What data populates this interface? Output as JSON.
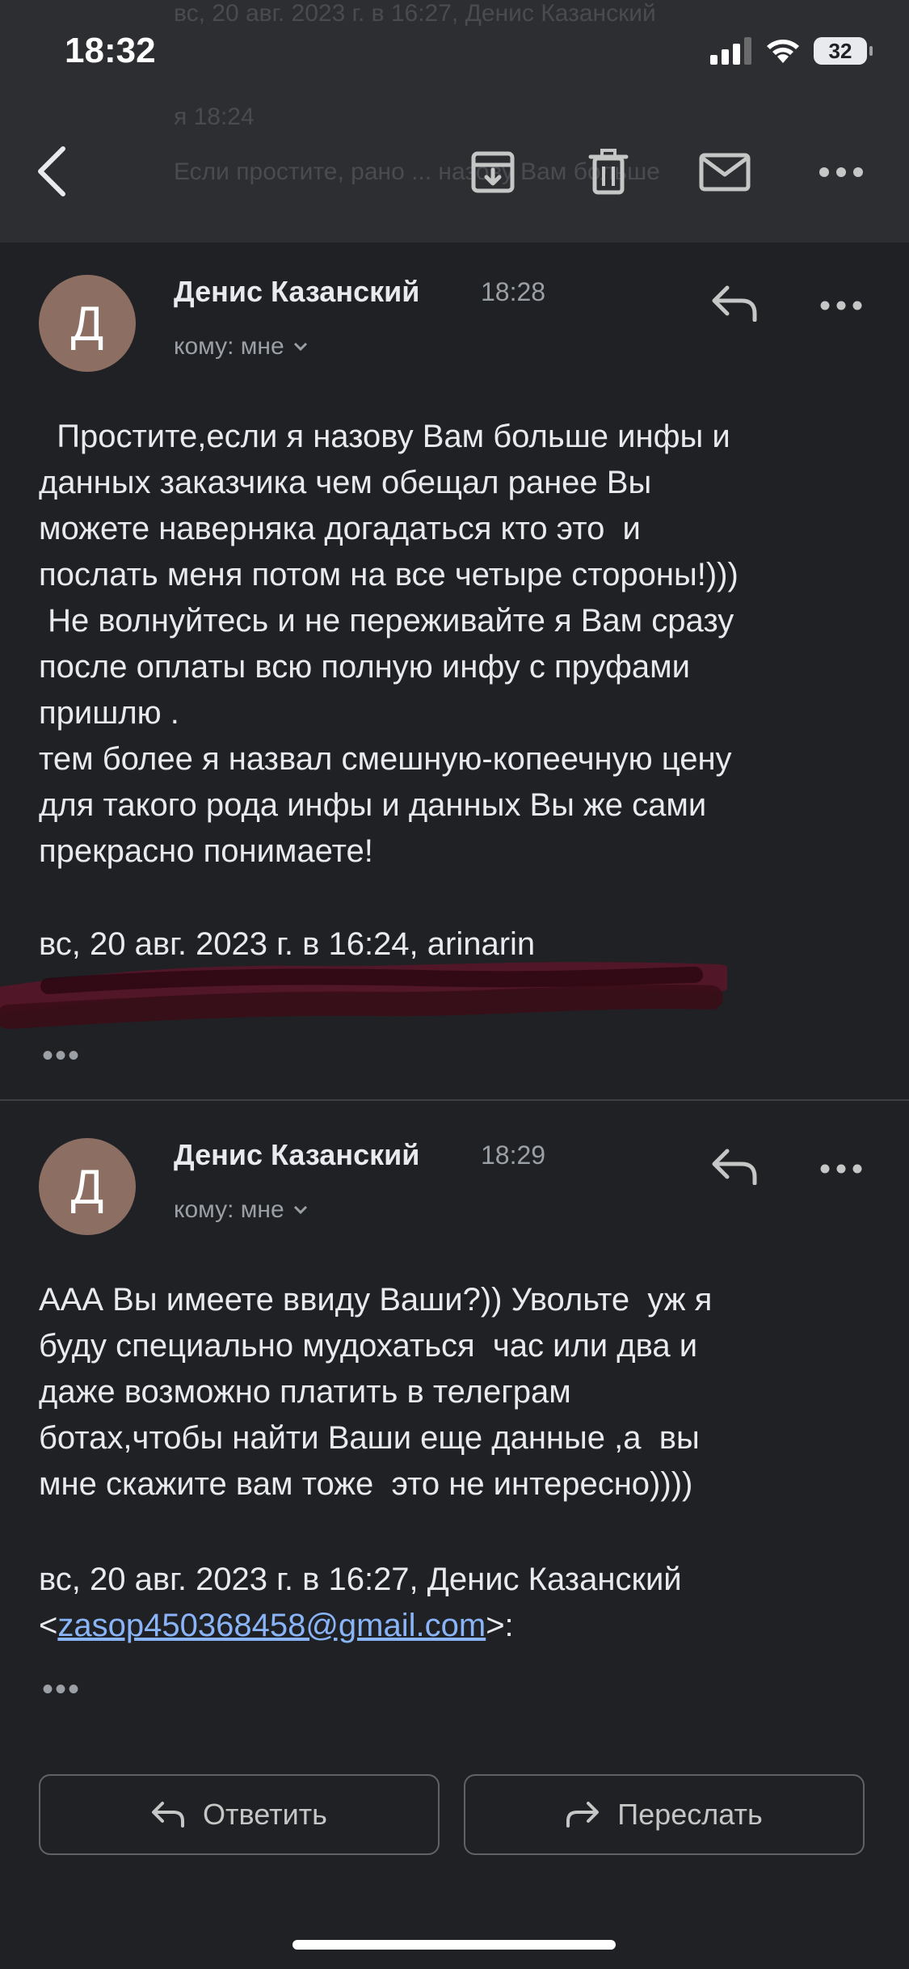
{
  "status_bar": {
    "time": "18:32",
    "battery": "32"
  },
  "background_header": {
    "line1": "вс, 20 авг. 2023 г. в 16:27, Денис Казанский",
    "line2": "я 18:24",
    "line3": "Если простите, рано ... назову Вам больше"
  },
  "toolbar": {
    "back": "back-icon",
    "archive": "archive-icon",
    "delete": "trash-icon",
    "mark_unread": "mail-icon",
    "more": "more-icon"
  },
  "messages": [
    {
      "avatar_letter": "Д",
      "sender": "Денис Казанский",
      "time": "18:28",
      "to": "кому: мне",
      "body": "  Простите,если я назову Вам больше инфы и\nданных заказчика чем обещал ранее Вы\nможете наверняка догадаться кто это  и\nпослать меня потом на все четыре стороны!)))\n Не волнуйтесь и не переживайте я Вам сразу\nпосле оплаты всю полную инфу с пруфами\nпришлю .\nтем более я назвал смешную-копеечную цену\nдля такого рода инфы и данных Вы же сами\nпрекрасно понимаете!",
      "quote_line": "вс, 20 авг. 2023 г. в 16:24, arinarin",
      "ellipsis": "•••"
    },
    {
      "avatar_letter": "Д",
      "sender": "Денис Казанский",
      "time": "18:29",
      "to": "кому: мне",
      "body": "ААА Вы имеете ввиду Ваши?)) Увольте  уж я\nбуду специально мудохаться  час или два и\nдаже возможно платить в телеграм\nботах,чтобы найти Ваши еще данные ,а  вы\nмне скажите вам тоже  это не интересно))))",
      "quote_line": "вс, 20 авг. 2023 г. в 16:27, Денис Казанский",
      "quote_email_prefix": "<",
      "quote_email": "zasop450368458@gmail.com",
      "quote_email_suffix": ">:",
      "ellipsis": "•••"
    }
  ],
  "actions": {
    "reply": "Ответить",
    "forward": "Переслать"
  },
  "colors": {
    "background": "#202124",
    "toolbar": "#2d2e31",
    "link": "#8ab4f8",
    "avatar": "#8d6e63",
    "redaction": "#3a0d18"
  }
}
